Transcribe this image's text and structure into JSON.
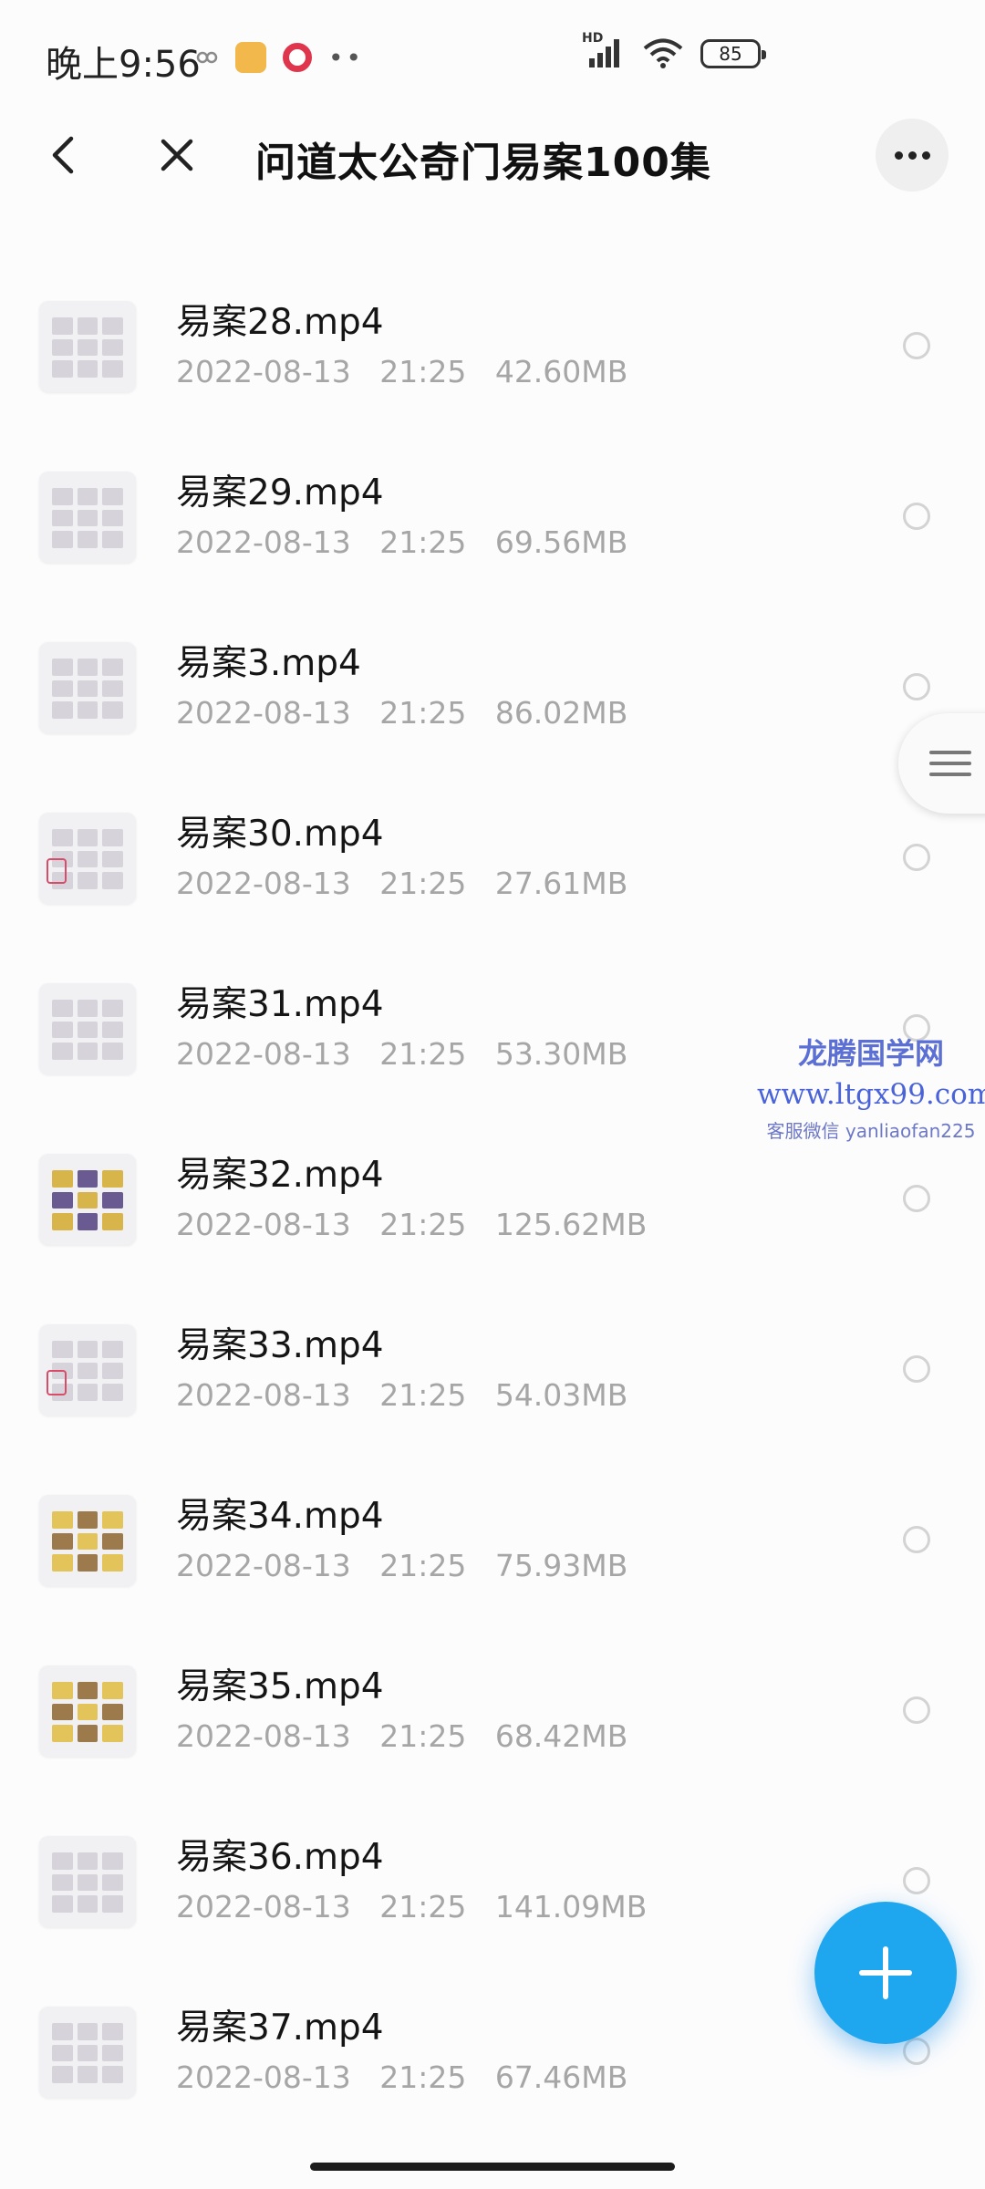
{
  "status_bar": {
    "time": "晚上9:56",
    "network_label": "HD",
    "battery": "85"
  },
  "header": {
    "title": "问道太公奇门易案100集"
  },
  "files": [
    {
      "name": "易案28.mp4",
      "meta": "2022-08-13   21:25   42.60MB"
    },
    {
      "name": "易案29.mp4",
      "meta": "2022-08-13   21:25   69.56MB"
    },
    {
      "name": "易案3.mp4",
      "meta": "2022-08-13   21:25   86.02MB"
    },
    {
      "name": "易案30.mp4",
      "meta": "2022-08-13   21:25   27.61MB"
    },
    {
      "name": "易案31.mp4",
      "meta": "2022-08-13   21:25   53.30MB"
    },
    {
      "name": "易案32.mp4",
      "meta": "2022-08-13   21:25   125.62MB"
    },
    {
      "name": "易案33.mp4",
      "meta": "2022-08-13   21:25   54.03MB"
    },
    {
      "name": "易案34.mp4",
      "meta": "2022-08-13   21:25   75.93MB"
    },
    {
      "name": "易案35.mp4",
      "meta": "2022-08-13   21:25   68.42MB"
    },
    {
      "name": "易案36.mp4",
      "meta": "2022-08-13   21:25   141.09MB"
    },
    {
      "name": "易案37.mp4",
      "meta": "2022-08-13   21:25   67.46MB"
    }
  ],
  "watermark": {
    "line1": "龙腾国学网",
    "line2": "www.ltgx99.com",
    "line3": "客服微信 yanliaofan225"
  },
  "icons": {
    "back": "back-arrow-icon",
    "close": "close-icon",
    "more": "more-dots-icon",
    "fab": "plus-icon",
    "side": "menu-lines-icon"
  },
  "colors": {
    "accent": "#1ea7ef",
    "meta_text": "#a6a6a6",
    "watermark": "#5b6fd4"
  }
}
